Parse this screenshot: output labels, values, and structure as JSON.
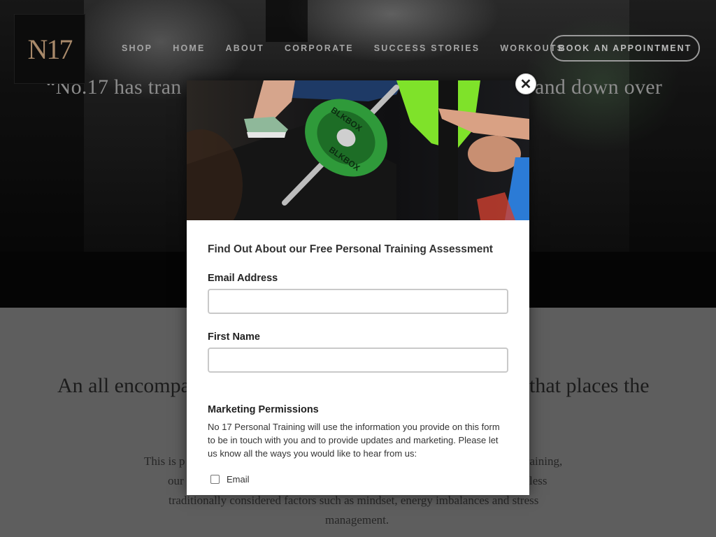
{
  "site": {
    "logo_text": "N17",
    "nav": [
      "SHOP",
      "HOME",
      "ABOUT",
      "CORPORATE",
      "SUCCESS STORIES",
      "WORKOUTS"
    ],
    "book_button": "BOOK AN APPOINTMENT"
  },
  "hero": {
    "quote_left": "“No.17 has tran",
    "quote_right": "and down over"
  },
  "section2": {
    "heading_left": "An all encompa",
    "heading_right": "that places the",
    "body_lines": [
      "This is p",
      "Training,",
      "our",
      "less",
      "traditionally considered factors such as mindset, energy imbalances and stress",
      "management."
    ]
  },
  "modal": {
    "close_glyph": "✕",
    "title": "Find Out About our Free Personal Training Assessment",
    "email_label": "Email Address",
    "email_value": "",
    "first_name_label": "First Name",
    "first_name_value": "",
    "permissions_title": "Marketing Permissions",
    "permissions_text": "No 17 Personal Training will use the information you provide on this form to be in touch with you and to provide updates and marketing. Please let us know all the ways you would like to hear from us:",
    "checkbox_label": "Email",
    "checkbox_checked": false,
    "image_plate_text": "BLKBOX"
  },
  "colors": {
    "accent_gold": "#a8896a",
    "plate_green": "#2f9a3a",
    "shirt_green": "#7fe22a",
    "section_grey": "#5e5e5e"
  }
}
